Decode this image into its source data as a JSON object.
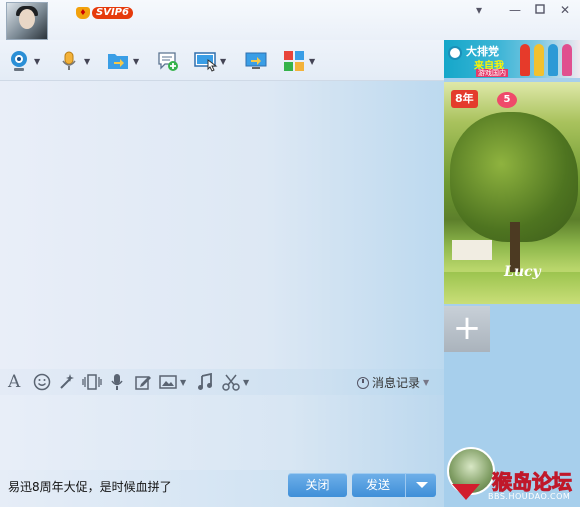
{
  "header": {
    "vip_badge": "SVIP6",
    "window_controls": [
      "chevron-down-icon",
      "minimize-icon",
      "maximize-icon",
      "close-icon"
    ]
  },
  "toolbar": {
    "items": [
      {
        "icon": "webcam-icon",
        "has_dropdown": true
      },
      {
        "icon": "microphone-icon",
        "has_dropdown": true
      },
      {
        "icon": "file-transfer-icon",
        "has_dropdown": true
      },
      {
        "icon": "new-discussion-icon",
        "has_dropdown": false
      },
      {
        "icon": "remote-desktop-icon",
        "has_dropdown": true
      },
      {
        "icon": "share-screen-icon",
        "has_dropdown": false
      },
      {
        "icon": "apps-icon",
        "has_dropdown": true
      }
    ]
  },
  "input_toolbar": {
    "items": [
      "font-icon",
      "emoji-icon",
      "magic-icon",
      "shake-icon",
      "voice-message-icon",
      "edit-icon",
      "image-icon",
      "music-icon",
      "screenshot-icon"
    ],
    "history_label": "消息记录"
  },
  "bottom": {
    "ad_text": "易迅8周年大促，是时候血拼了",
    "close_label": "关闭",
    "send_label": "发送"
  },
  "side_panel": {
    "banner": {
      "title": "大排党",
      "subtitle": "来自我",
      "tag": "游戏国内"
    },
    "badges": {
      "years": "8年",
      "hearts": "5"
    },
    "photo_caption": "Lucy",
    "add_button_label": "+"
  },
  "watermark": {
    "title": "猴岛论坛",
    "url": "BBS.HOUDAO.COM"
  },
  "colors": {
    "button_blue": "#4a98de",
    "accent_red": "#e43b2c"
  }
}
